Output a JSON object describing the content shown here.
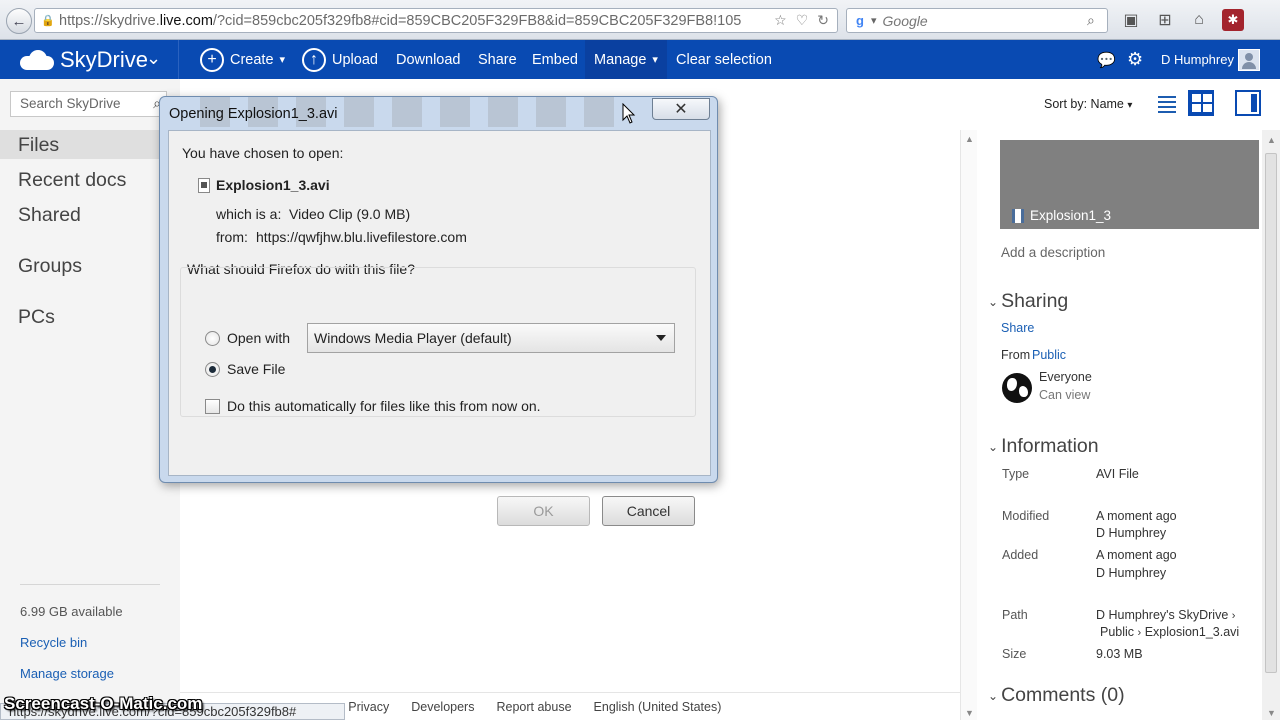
{
  "browser": {
    "url_prefix": "https://skydrive.",
    "url_domain": "live.com",
    "url_suffix": "/?cid=859cbc205f329fb8#cid=859CBC205F329FB8&id=859CBC205F329FB8!105",
    "search_placeholder": "Google",
    "status_url": "https://skydrive.live.com/?cid=859cbc205f329fb8#"
  },
  "cmdbar": {
    "brand": "SkyDrive",
    "create": "Create",
    "upload": "Upload",
    "download": "Download",
    "share": "Share",
    "embed": "Embed",
    "manage": "Manage",
    "clear_selection": "Clear selection",
    "user_name": "D Humphrey"
  },
  "leftnav": {
    "search_placeholder": "Search SkyDrive",
    "items": [
      "Files",
      "Recent docs",
      "Shared",
      "Groups",
      "PCs"
    ],
    "storage": "6.99 GB available",
    "recycle_bin": "Recycle bin",
    "manage_storage": "Manage storage"
  },
  "main": {
    "sort_label": "Sort by: Name",
    "footer_links": [
      "Privacy",
      "Developers",
      "Report abuse",
      "English (United States)"
    ],
    "footer_partial": "s"
  },
  "details": {
    "file_title": "Explosion1_3",
    "add_description": "Add a description",
    "sharing_header": "Sharing",
    "share_link": "Share",
    "from_label": "From",
    "from_value": "Public",
    "everyone": "Everyone",
    "can_view": "Can view",
    "information_header": "Information",
    "info": {
      "type_label": "Type",
      "type_value": "AVI File",
      "modified_label": "Modified",
      "modified_value": "A moment ago",
      "modified_by": "D Humphrey",
      "added_label": "Added",
      "added_value": "A moment ago",
      "added_by": "D Humphrey",
      "path_label": "Path",
      "path_line1": "D Humphrey's SkyDrive",
      "path_line2a": "Public",
      "path_line2b": "Explosion1_3.avi",
      "size_label": "Size",
      "size_value": "9.03 MB"
    },
    "comments_header": "Comments (0)"
  },
  "dialog": {
    "title": "Opening Explosion1_3.avi",
    "intro": "You have chosen to open:",
    "filename": "Explosion1_3.avi",
    "which_is_label": "which is a:",
    "which_is_value": "Video Clip (9.0 MB)",
    "from_label": "from:",
    "from_value": "https://qwfjhw.blu.livefilestore.com",
    "question": "What should Firefox do with this file?",
    "open_with_label": "Open with",
    "open_with_value": "Windows Media Player (default)",
    "save_file_label": "Save File",
    "auto_label": "Do this automatically for files like this from now on.",
    "ok_label": "OK",
    "cancel_label": "Cancel",
    "selected_option": "Save File",
    "auto_checked": false
  },
  "watermark": "Screencast-O-Matic.com",
  "colors": {
    "brand_blue": "#094ab2",
    "link_blue": "#1a5fb4",
    "thumb_gray": "#808080"
  }
}
